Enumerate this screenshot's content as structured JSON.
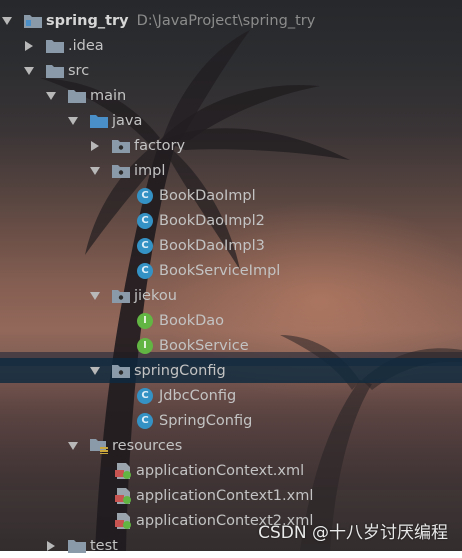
{
  "tree": {
    "project": {
      "name": "spring_try",
      "path": "D:\\JavaProject\\spring_try"
    },
    "idea": ".idea",
    "src": "src",
    "main": "main",
    "java": "java",
    "factory": "factory",
    "impl": "impl",
    "impl_classes": [
      "BookDaoImpl",
      "BookDaoImpl2",
      "BookDaoImpl3",
      "BookServiceImpl"
    ],
    "jiekou": "jiekou",
    "jiekou_interfaces": [
      "BookDao",
      "BookService"
    ],
    "springConfig": "springConfig",
    "springConfig_classes": [
      "JdbcConfig",
      "SpringConfig"
    ],
    "resources": "resources",
    "resource_files": [
      "applicationContext.xml",
      "applicationContext1.xml",
      "applicationContext2.xml"
    ],
    "test": "test"
  },
  "icons": {
    "class_letter": "C",
    "interface_letter": "I"
  },
  "colors": {
    "class_icon": "#3592c4",
    "interface_icon": "#62b543",
    "folder": "#8a9aa8",
    "source_folder": "#4a8fc8",
    "selection": "#0d293e"
  },
  "watermark": "CSDN @十八岁讨厌编程"
}
